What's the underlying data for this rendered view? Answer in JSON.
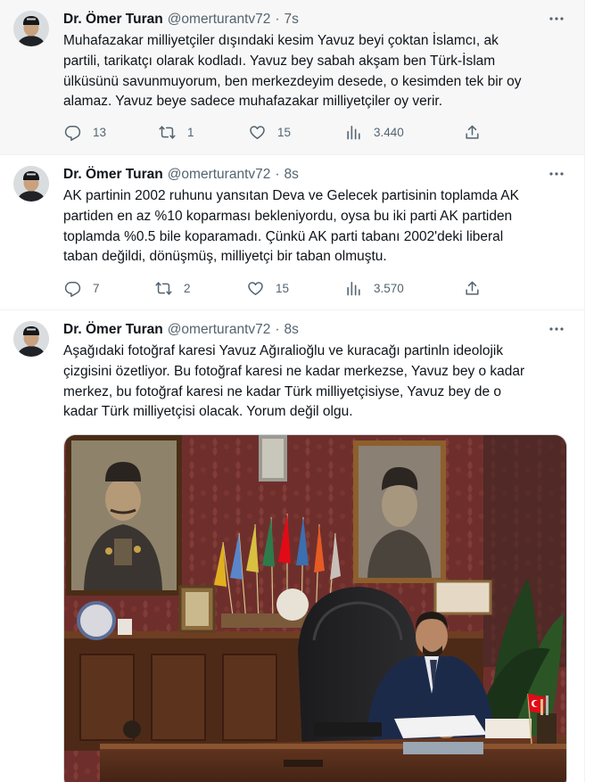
{
  "tweets": [
    {
      "name": "Dr. Ömer Turan",
      "handle": "@omerturantv72",
      "time": "7s",
      "lines": [
        "Muhafazakar milliyetçiler dışındaki kesim Yavuz beyi çoktan İslamcı, ak",
        "partili, tarikatçı olarak kodladı. Yavuz bey sabah akşam ben Türk-İslam",
        "ülküsünü savunmuyorum, ben merkezdeyim desede, o kesimden tek bir oy",
        "alamaz. Yavuz beye sadece muhafazakar milliyetçiler oy verir."
      ],
      "replies": "13",
      "retweets": "1",
      "likes": "15",
      "views": "3.440"
    },
    {
      "name": "Dr. Ömer Turan",
      "handle": "@omerturantv72",
      "time": "8s",
      "lines": [
        "AK partinin 2002 ruhunu yansıtan Deva ve Gelecek partisinin toplamda AK",
        "partiden en az %10 koparması bekleniyordu, oysa bu iki parti AK partiden",
        "toplamda %0.5 bile koparamadı. Çünkü AK parti tabanı 2002'deki liberal",
        "taban değildi, dönüşmüş, milliyetçi bir taban olmuştu."
      ],
      "replies": "7",
      "retweets": "2",
      "likes": "15",
      "views": "3.570"
    },
    {
      "name": "Dr. Ömer Turan",
      "handle": "@omerturantv72",
      "time": "8s",
      "lines": [
        "Aşağıdaki fotoğraf karesi Yavuz Ağıralioğlu ve kuracağı partinln ideolojik",
        "çizgisini özetliyor. Bu fotoğraf karesi ne kadar merkezse, Yavuz bey o kadar",
        "merkez, bu fotoğraf karesi ne kadar Türk milliyetçisiyse, Yavuz bey de o",
        "kadar Türk milliyetçisi olacak. Yorum değil olgu."
      ]
    }
  ],
  "dot": "·",
  "colors": {
    "text": "#0f1419",
    "secondary": "#536471",
    "border": "#eff3f4",
    "flag_red": "#e30a17"
  }
}
